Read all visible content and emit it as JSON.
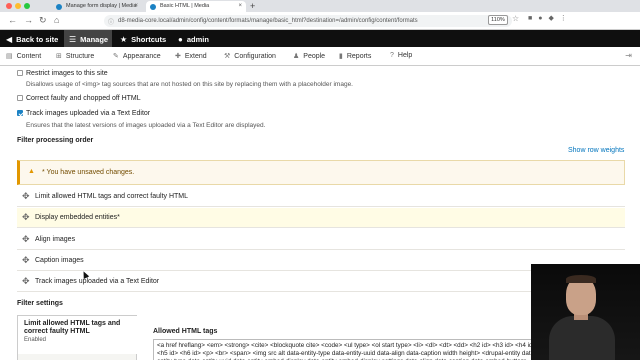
{
  "browser": {
    "tabs": [
      {
        "title": "Manage form display | Media"
      },
      {
        "title": "Basic HTML | Media"
      }
    ],
    "url": "d8-media-core.local/admin/config/content/formats/manage/basic_html?destination=/admin/config/content/formats",
    "zoom": "110%"
  },
  "admin_toolbar": {
    "back": "Back to site",
    "manage": "Manage",
    "shortcuts": "Shortcuts",
    "user": "admin"
  },
  "tray": {
    "items": [
      "Content",
      "Structure",
      "Appearance",
      "Extend",
      "Configuration",
      "People",
      "Reports",
      "Help"
    ]
  },
  "options": [
    {
      "label": "Restrict images to this site",
      "checked": false,
      "description": "Disallows usage of <img> tag sources that are not hosted on this site by replacing them with a placeholder image."
    },
    {
      "label": "Correct faulty and chopped off HTML",
      "checked": false,
      "description": ""
    },
    {
      "label": "Track images uploaded via a Text Editor",
      "checked": true,
      "description": "Ensures that the latest versions of images uploaded via a Text Editor are displayed."
    }
  ],
  "processing": {
    "title": "Filter processing order",
    "show_weights": "Show row weights",
    "warning": "* You have unsaved changes.",
    "rows": [
      {
        "label": "Limit allowed HTML tags and correct faulty HTML",
        "highlight": false
      },
      {
        "label": "Display embedded entities*",
        "highlight": true
      },
      {
        "label": "Align images",
        "highlight": false
      },
      {
        "label": "Caption images",
        "highlight": false
      },
      {
        "label": "Track images uploaded via a Text Editor",
        "highlight": false
      }
    ]
  },
  "settings": {
    "title": "Filter settings",
    "vtab_name": "Limit allowed HTML tags and correct faulty HTML",
    "vtab_status": "Enabled",
    "allowed_label": "Allowed HTML tags",
    "allowed_value": "<a href hreflang> <em> <strong> <cite> <blockquote cite> <code> <ul type> <ol start type> <li> <dl> <dt> <dd> <h2 id> <h3 id> <h4 id> <h5 id> <h6 id> <p> <br> <span> <img src alt data-entity-type data-entity-uuid data-align data-caption width height> <drupal-entity data-entity-type data-entity-uuid data-entity-embed-display data-entity-embed-display-settings data-align data-caption data-embed-button>"
  },
  "colors": {
    "accent": "#1b82c4",
    "warning_border": "#e29700",
    "highlight_row": "#fffce5",
    "admin_bar": "#0f0f0f"
  }
}
